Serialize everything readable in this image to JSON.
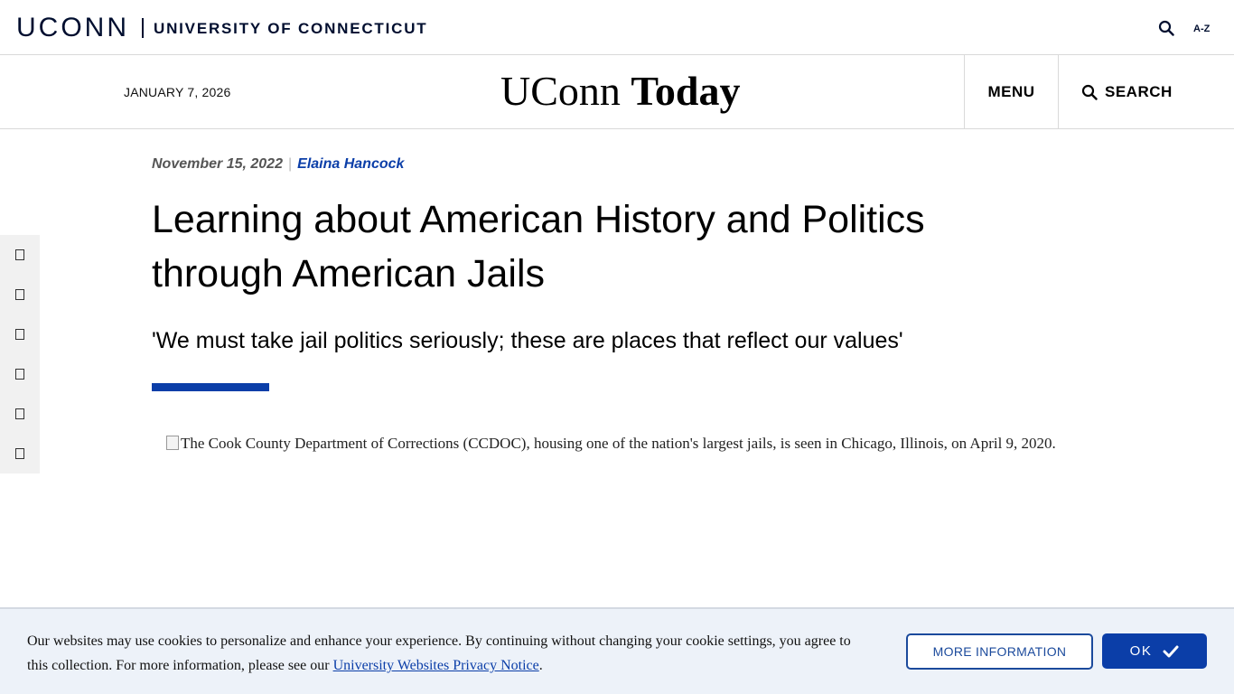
{
  "uni_bar": {
    "logo": "UCONN",
    "university_name": "UNIVERSITY OF CONNECTICUT",
    "search_icon": "search-icon",
    "az_label": "A-Z"
  },
  "header": {
    "date": "JANUARY 7, 2026",
    "site_title_part1": "UConn",
    "site_title_part2": "Today",
    "menu_label": "MENU",
    "search_label": "SEARCH"
  },
  "share_bar": {
    "icons": [
      "share-icon-1",
      "share-icon-2",
      "share-icon-3",
      "share-icon-4",
      "share-icon-5",
      "share-icon-6"
    ]
  },
  "article": {
    "date": "November 15, 2022",
    "separator": "|",
    "author": "Elaina Hancock",
    "headline_line1": "Learning about American History and Politics",
    "headline_line2": "through American Jails",
    "subhead": "'We must take jail politics seriously; these are places that reflect our values'",
    "image_alt": "The Cook County Department of Corrections (CCDOC), housing one of the nation's largest jails, is seen in Chicago, Illinois, on April 9, 2020."
  },
  "cookie_banner": {
    "text": "Our websites may use cookies to personalize and enhance your experience. By continuing without changing your cookie settings, you agree to this collection. For more information, please see our ",
    "link_text": "University Websites Privacy Notice",
    "text_end": ".",
    "more_info_label": "MORE INFORMATION",
    "ok_label": "OK"
  },
  "colors": {
    "brand_navy": "#000e2f",
    "accent_blue": "#0b3ea8",
    "cookie_bg": "#edf2f9"
  }
}
